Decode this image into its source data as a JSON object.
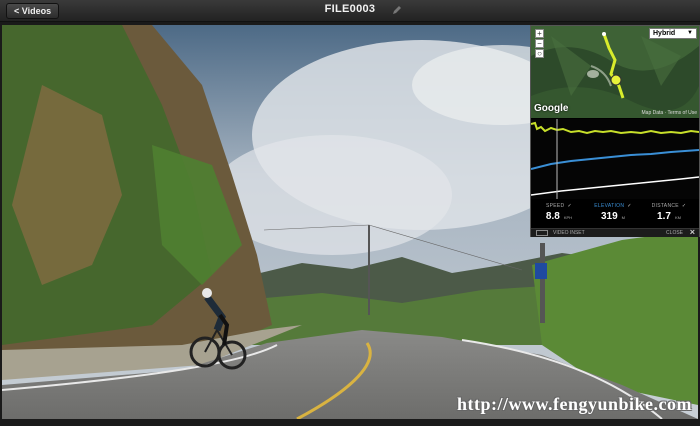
{
  "topbar": {
    "back_label": "< Videos",
    "title": "FILE0003"
  },
  "watermark": "http://www.fengyunbike.com",
  "map": {
    "zoom_in": "+",
    "zoom_out": "−",
    "map_type": "Hybrid",
    "logo": "Google",
    "terms": "Map Data · Terms of Use"
  },
  "stats": {
    "speed": {
      "label": "SPEED",
      "value": "8.8",
      "unit": "KPH"
    },
    "elevation": {
      "label": "ELEVATION",
      "value": "319",
      "unit": "M"
    },
    "distance": {
      "label": "DISTANCE",
      "value": "1.7",
      "unit": "KM"
    }
  },
  "inset": {
    "label": "VIDEO INSET",
    "close_label": "CLOSE",
    "close_icon": "×"
  },
  "colors": {
    "speed": "#c8e02a",
    "elevation": "#3a8fd6",
    "distance": "#ffffff"
  }
}
